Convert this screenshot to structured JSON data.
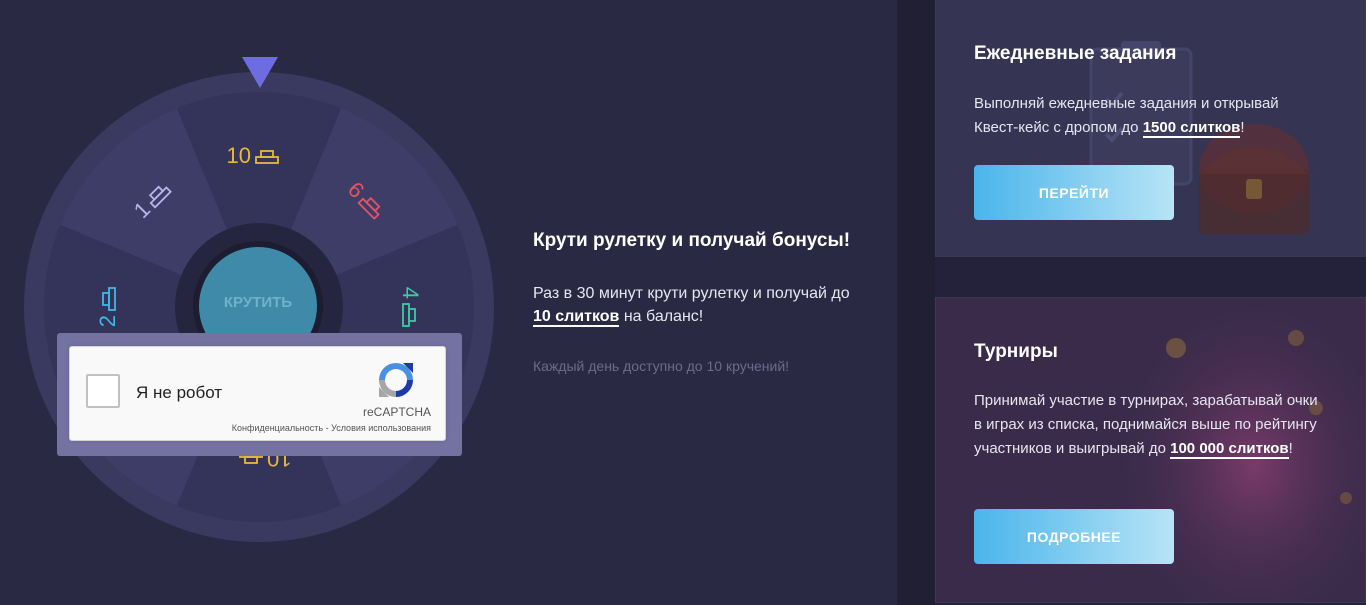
{
  "wheel": {
    "segments": [
      {
        "value": "10",
        "color": "#e6b93a"
      },
      {
        "value": "6",
        "color": "#e15566"
      },
      {
        "value": "4",
        "color": "#3fc9a4"
      },
      {
        "value": "4",
        "color": "#6aa8e8"
      },
      {
        "value": "10",
        "color": "#e6b93a"
      },
      {
        "value": "2",
        "color": "#6aa8e8"
      },
      {
        "value": "2",
        "color": "#3fb8e8"
      },
      {
        "value": "1",
        "color": "#b7b4e8"
      }
    ],
    "spin_label": "КРУТИТЬ",
    "pointer_color": "#6d6de0"
  },
  "captcha": {
    "label": "Я не робот",
    "brand": "reCAPTCHA",
    "privacy_link": "Конфиденциальность",
    "separator": " - ",
    "terms_link": "Условия использования"
  },
  "promo": {
    "title": "Крути рулетку и получай бонусы!",
    "desc_before": "Раз в 30 минут крути рулетку и получай до ",
    "desc_bold": "10 слитков",
    "desc_after": " на баланс!",
    "note": "Каждый день доступно до 10 кручений!"
  },
  "daily_tasks": {
    "title": "Ежедневные задания",
    "desc_before": "Выполняй ежедневные задания и открывай Квест-кейс с дропом до ",
    "desc_bold": "1500 слитков",
    "desc_after": "!",
    "button": "ПЕРЕЙТИ"
  },
  "tournaments": {
    "title": "Турниры",
    "desc_before": "Принимай участие в турнирах, зарабатывай очки в играх из списка, поднимайся выше по рейтингу участников и выигрывай до ",
    "desc_bold": "100 000 слитков",
    "desc_after": "!",
    "button": "ПОДРОБНЕЕ"
  }
}
